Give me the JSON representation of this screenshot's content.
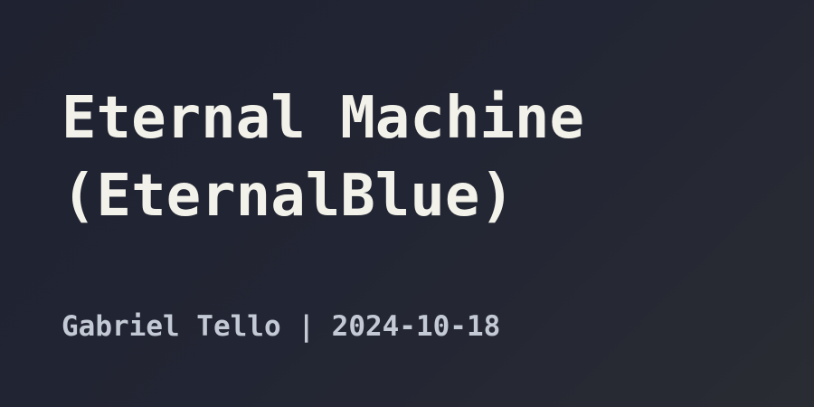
{
  "post": {
    "title_line_1": "Eternal Machine",
    "title_line_2": "(EternalBlue)",
    "author": "Gabriel Tello",
    "separator": "|",
    "date": "2024-10-18"
  },
  "colors": {
    "background": "#222533",
    "title": "#f3f2ea",
    "meta": "#c4c9d6"
  }
}
